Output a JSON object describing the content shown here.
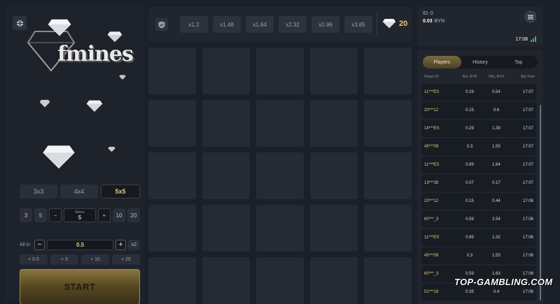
{
  "game": {
    "logo_text": "fmines",
    "size_options": [
      "3x3",
      "4x4",
      "5x5"
    ],
    "mines_presets_left": [
      "3",
      "5"
    ],
    "mines_presets_right": [
      "10",
      "20"
    ],
    "mines_label": "Mines",
    "mines_value": "5",
    "minus": "−",
    "plus": "+",
    "all_in_label": "All in",
    "bet_value": "0.5",
    "double_label": "x2",
    "quick_bets": [
      "+ 0.5",
      "+ 5",
      "+ 10",
      "+ 25"
    ],
    "start_label": "START"
  },
  "multipliers": [
    "x1.2",
    "x1.48",
    "x1.84",
    "x2.32",
    "x2.96",
    "x3.85"
  ],
  "gems_count": "20",
  "account": {
    "id_label": "ID: 0",
    "balance": "0.03",
    "currency": "BYN",
    "time": "17:08"
  },
  "tabs": [
    "Players",
    "History",
    "Top"
  ],
  "table": {
    "headers": [
      "Player ID",
      "Bet, BYN",
      "Win, BYN",
      "Bet Time"
    ],
    "rows": [
      [
        "11***ES",
        "0.29",
        "0.54",
        "17:07"
      ],
      [
        "20***12",
        "0.15",
        "0.6",
        "17:07"
      ],
      [
        "14***ES",
        "0.29",
        "1.39",
        "17:07"
      ],
      [
        "45***09",
        "0.3",
        "1.55",
        "17:07"
      ],
      [
        "11***ES",
        "0.89",
        "1.64",
        "17:07"
      ],
      [
        "13***38",
        "0.07",
        "0.17",
        "17:07"
      ],
      [
        "20***12",
        "0.15",
        "0.44",
        "17:06"
      ],
      [
        "60***_3",
        "0.59",
        "2.54",
        "17:06"
      ],
      [
        "11***ES",
        "0.89",
        "1.32",
        "17:06"
      ],
      [
        "45***09",
        "0.3",
        "1.55",
        "17:06"
      ],
      [
        "60***_3",
        "0.59",
        "1.63",
        "17:06"
      ],
      [
        "51***19",
        "0.35",
        "0.4",
        "17:06"
      ]
    ]
  },
  "watermark": "TOP-GAMBLING.COM",
  "colors": {
    "accent_gold": "#e8c978",
    "background": "#1b1f28",
    "cell": "#252a33",
    "signal_green": "#4caf50"
  }
}
